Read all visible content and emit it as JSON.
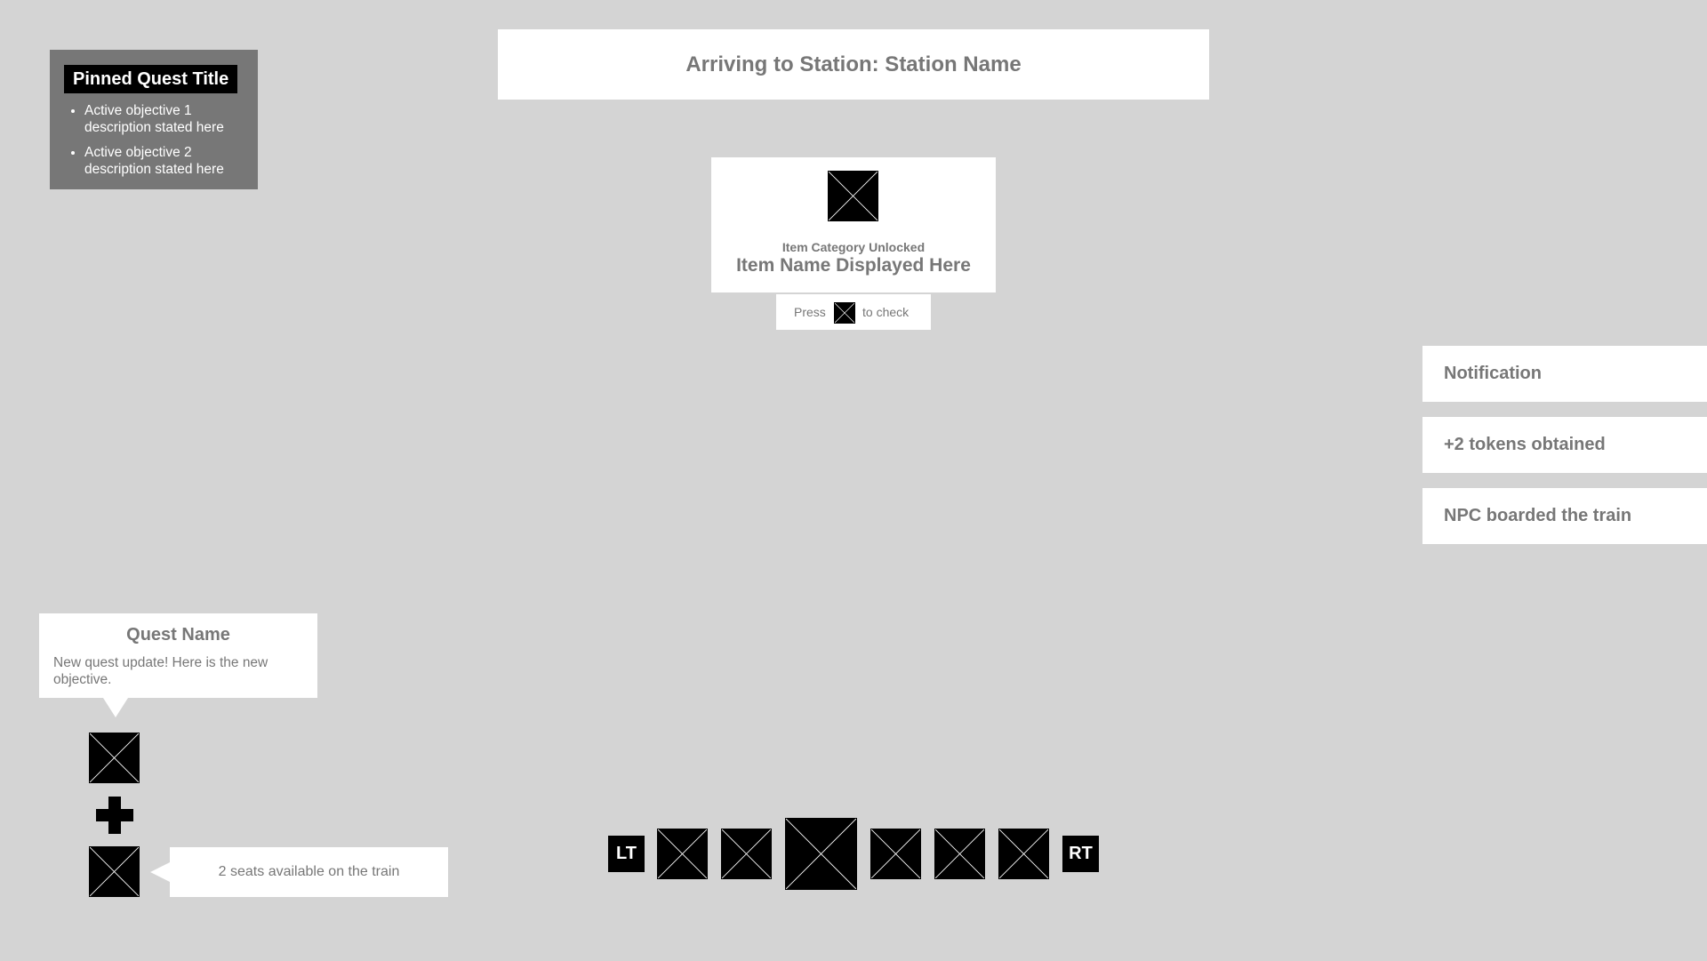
{
  "pinned_quest": {
    "title": "Pinned Quest Title",
    "objectives": [
      "Active objective 1 description stated here",
      "Active objective 2 description stated here"
    ]
  },
  "station_banner": {
    "text": "Arriving to Station: Station Name"
  },
  "unlock": {
    "category": "Item Category Unlocked",
    "item_name": "Item Name Displayed Here",
    "press_label": "Press",
    "check_label": "to check"
  },
  "notifications": [
    "Notification",
    "+2 tokens obtained",
    "NPC boarded the train"
  ],
  "quest_update": {
    "name": "Quest Name",
    "text": "New quest update! Here is the new objective."
  },
  "seats": {
    "text": "2 seats available on the train"
  },
  "hotbar": {
    "left_trigger": "LT",
    "right_trigger": "RT"
  },
  "colors": {
    "background": "#d4d4d4",
    "panel": "#ffffff",
    "pinned_bg": "#777777",
    "text": "#777777",
    "placeholder": "#000000"
  }
}
